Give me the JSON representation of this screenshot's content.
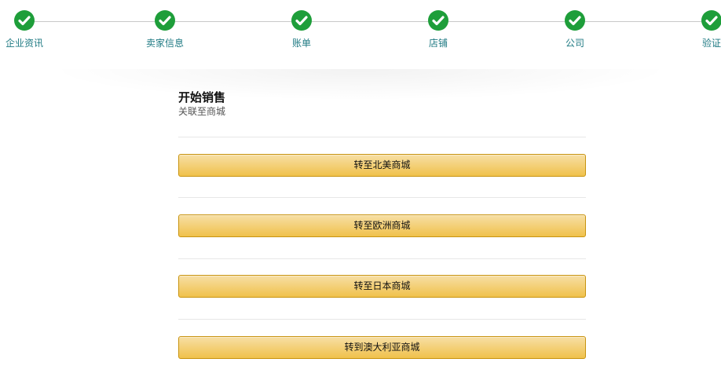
{
  "stepper": {
    "steps": [
      {
        "label": "企业资讯",
        "status": "completed",
        "icon": "check-icon"
      },
      {
        "label": "卖家信息",
        "status": "completed",
        "icon": "check-icon"
      },
      {
        "label": "账单",
        "status": "completed",
        "icon": "check-icon"
      },
      {
        "label": "店铺",
        "status": "completed",
        "icon": "check-icon"
      },
      {
        "label": "公司",
        "status": "completed",
        "icon": "check-icon"
      },
      {
        "label": "验证",
        "status": "completed",
        "icon": "check-icon"
      }
    ],
    "colors": {
      "check": "#1e9e3a",
      "label": "#1f7a83",
      "line": "#c9c9c9"
    }
  },
  "main": {
    "title": "开始销售",
    "subtitle": "关联至商城",
    "buttons": [
      {
        "label": "转至北美商城"
      },
      {
        "label": "转至欧洲商城"
      },
      {
        "label": "转至日本商城"
      },
      {
        "label": "转到澳大利亚商城"
      }
    ],
    "colors": {
      "button_top": "#f7dfa5",
      "button_bottom": "#f0c14b",
      "button_border": "#c89411"
    }
  }
}
